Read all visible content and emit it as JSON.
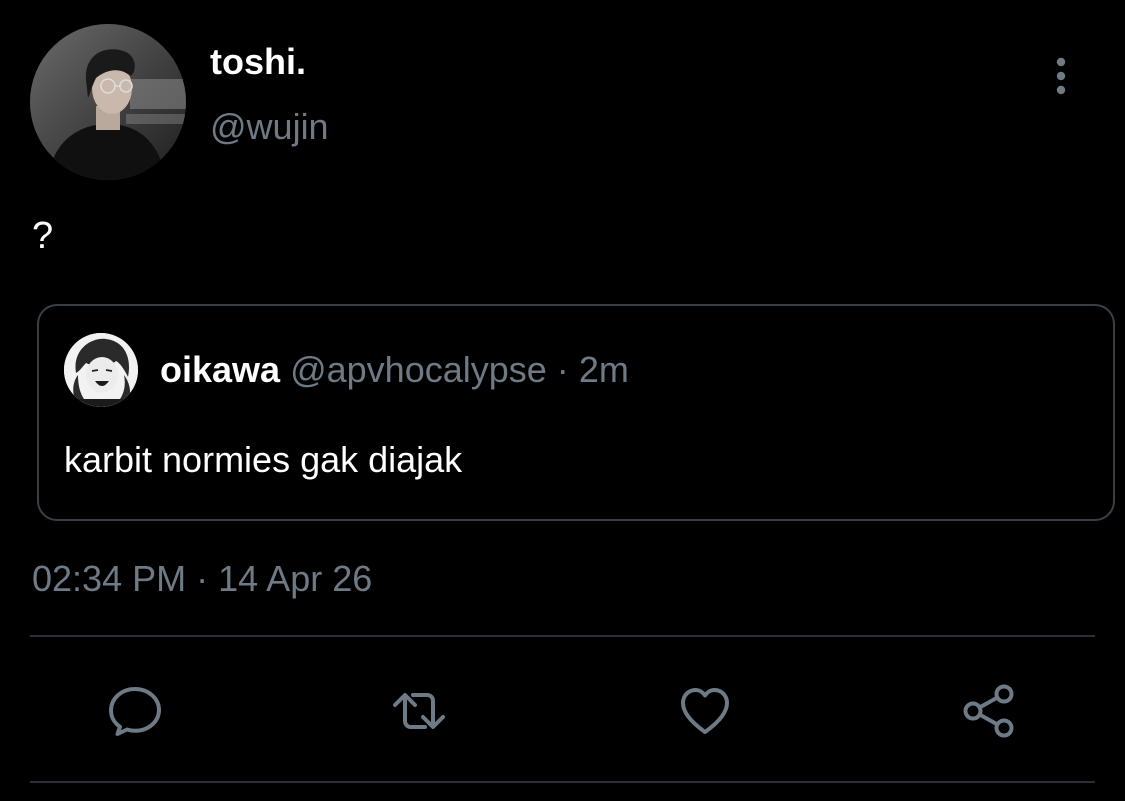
{
  "tweet": {
    "author": {
      "display_name": "toshi.",
      "handle": "@wujin"
    },
    "text": "?",
    "quoted": {
      "display_name": "oikawa",
      "handle": "@apvhocalypse",
      "separator": "·",
      "age": "2m",
      "text": "karbit normies gak diajak"
    },
    "time": "02:34 PM",
    "date_separator": "·",
    "date": "14 Apr 26"
  },
  "actions": [
    {
      "icon": "reply-icon"
    },
    {
      "icon": "retweet-icon"
    },
    {
      "icon": "like-icon"
    },
    {
      "icon": "share-icon"
    }
  ],
  "colors": {
    "background": "#000000",
    "text_primary": "#ffffff",
    "text_secondary": "#6e7a85",
    "border": "#3a3f45",
    "icon": "#6e7a85"
  }
}
